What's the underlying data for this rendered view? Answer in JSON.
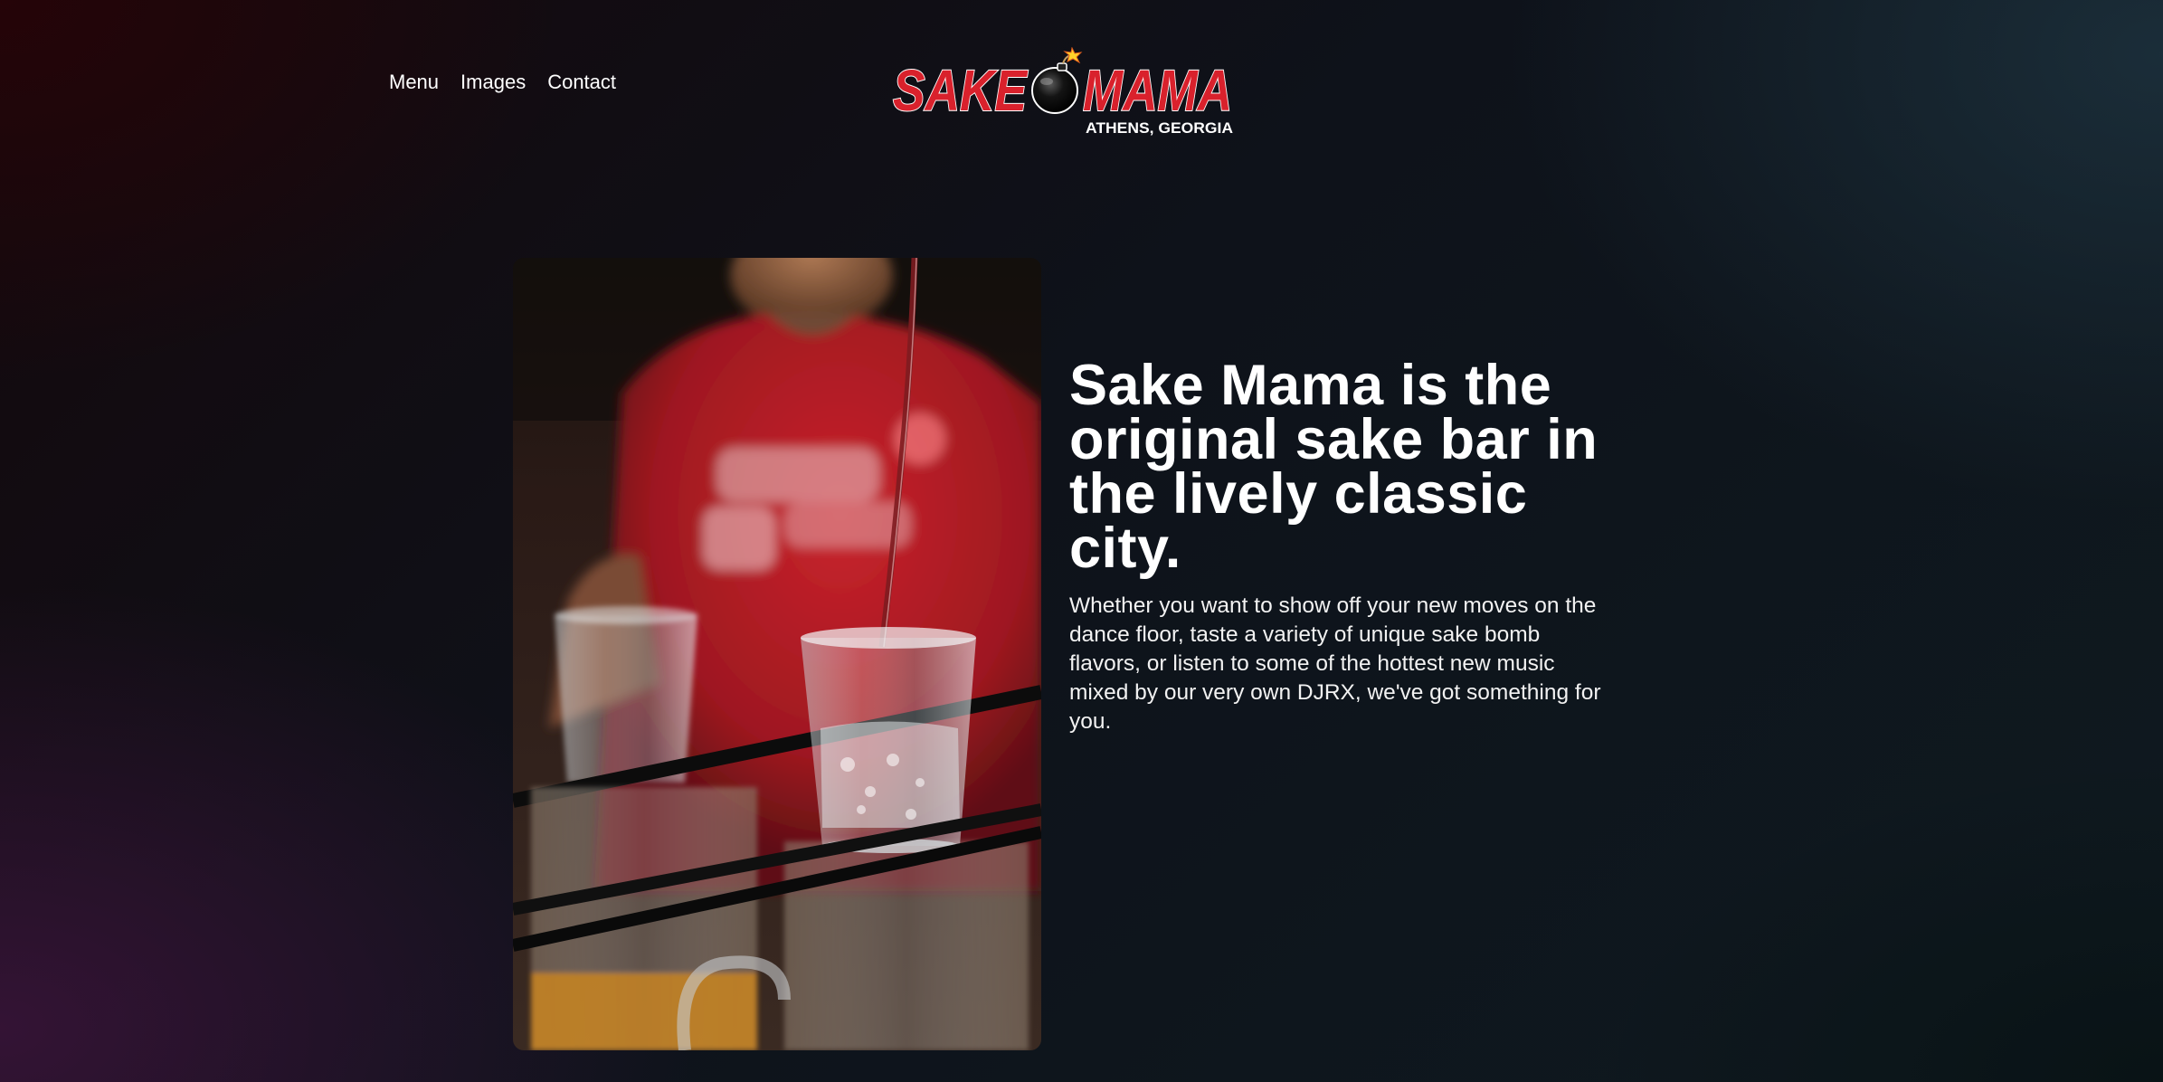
{
  "nav": {
    "items": [
      {
        "label": "Menu"
      },
      {
        "label": "Images"
      },
      {
        "label": "Contact"
      }
    ]
  },
  "logo": {
    "word_left": "SAKE",
    "word_right": "MAMA",
    "location": "ATHENS, GEORGIA",
    "brand_red": "#d9212c",
    "icon": "bomb-icon"
  },
  "hero": {
    "photo": {
      "description_icon": "sake-bomb-photo"
    },
    "title": "Sake Mama is the original sake bar in the lively classic city.",
    "body": "Whether you want to show off your new moves on the dance floor, taste a variety of unique sake bomb flavors, or listen to some of the hottest new music mixed by our very own DJRX, we've got something for you."
  },
  "colors": {
    "text": "#ffffff",
    "accent_red": "#d9212c"
  }
}
